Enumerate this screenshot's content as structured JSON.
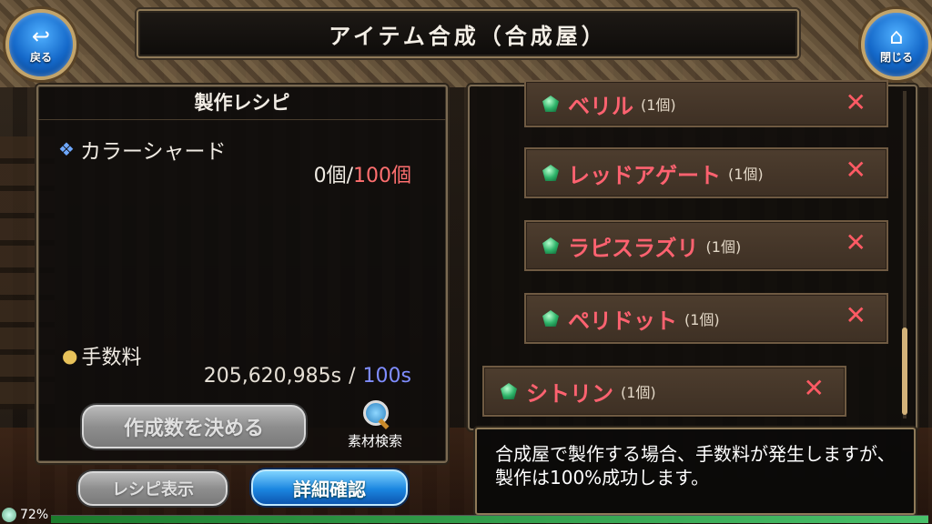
{
  "header": {
    "title": "アイテム合成（合成屋）"
  },
  "nav": {
    "back_label": "戻る",
    "close_label": "閉じる",
    "back_icon": "back-arrow-icon",
    "close_icon": "home-icon"
  },
  "recipe": {
    "header": "製作レシピ",
    "material": {
      "name": "カラーシャード",
      "have": "0個",
      "separator": "/",
      "need": "100個",
      "icon": "blue-shard-icon"
    },
    "fee": {
      "label": "手数料",
      "cost": "205,620,985s",
      "separator": "/",
      "have": "100s",
      "icon": "coin-icon"
    },
    "decide_button": "作成数を決める",
    "search_label": "素材検索"
  },
  "bottom_buttons": {
    "recipe_view": "レシピ表示",
    "details": "詳細確認"
  },
  "items": [
    {
      "name": "ベリル",
      "qty": "(1個)",
      "remove": "✕"
    },
    {
      "name": "レッドアゲート",
      "qty": "(1個)",
      "remove": "✕"
    },
    {
      "name": "ラピスラズリ",
      "qty": "(1個)",
      "remove": "✕"
    },
    {
      "name": "ペリドット",
      "qty": "(1個)",
      "remove": "✕"
    },
    {
      "name": "シトリン",
      "qty": "(1個)",
      "remove": "✕"
    }
  ],
  "description": "合成屋で製作する場合、手数料が発生しますが、製作は100%成功します。",
  "status": {
    "battery": "72%",
    "bar_fill": 1.0
  },
  "colors": {
    "accent_red": "#ff6270",
    "fee_blue": "#7f8dff",
    "gem_green": "#2fb46a"
  }
}
